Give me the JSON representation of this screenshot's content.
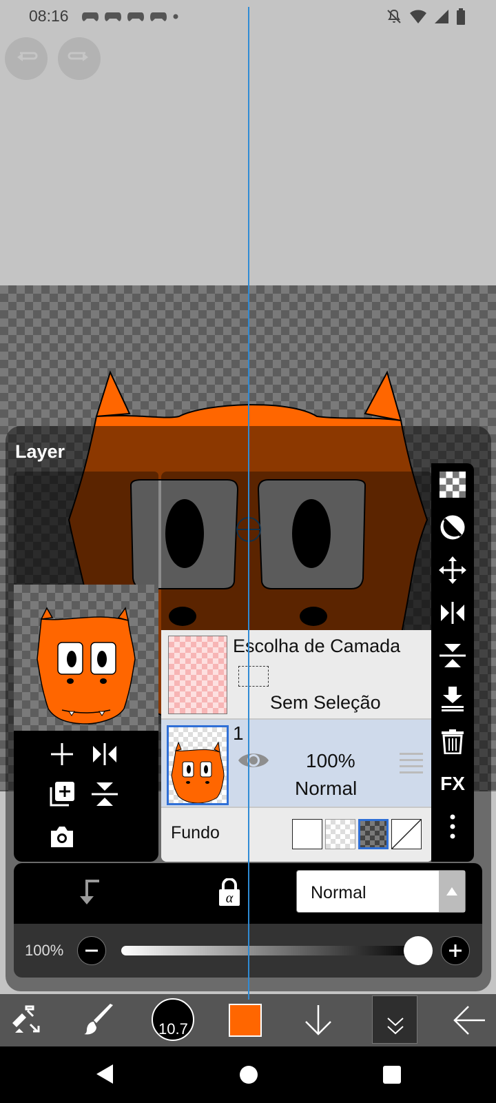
{
  "status_bar": {
    "time": "08:16",
    "left_icons": [
      "gamepad-icon",
      "gamepad-icon",
      "gamepad-icon",
      "gamepad-icon",
      "dot-icon"
    ],
    "right_icons": [
      "bell-off-icon",
      "wifi-icon",
      "signal-icon",
      "battery-icon"
    ]
  },
  "toolbar_top": {
    "undo_icon": "undo-icon",
    "redo_icon": "redo-icon"
  },
  "layer_panel": {
    "title": "Layer",
    "selection_row": {
      "title": "Escolha de Camada",
      "status": "Sem Seleção"
    },
    "layers": [
      {
        "number": "1",
        "opacity": "100%",
        "blend_mode": "Normal",
        "visible": true,
        "selected": true
      }
    ],
    "background_row": {
      "label": "Fundo",
      "options": [
        "white",
        "checker-light",
        "checker-dark",
        "none"
      ],
      "selected_option": "checker-dark"
    },
    "side_tools": [
      "checker-icon",
      "clipping-icon",
      "move-icon",
      "flip-horizontal-icon",
      "flip-vertical-icon",
      "merge-down-icon",
      "trash-icon",
      "fx-icon",
      "more-icon"
    ],
    "fx_label": "FX",
    "blend_select": {
      "value": "Normal"
    },
    "opacity": {
      "label": "100%",
      "value": 1.0
    }
  },
  "bottom_toolbar": {
    "brush_size": "10.7",
    "current_color": "#ff6600"
  },
  "colors": {
    "accent_blue": "#2f8bd5",
    "character_orange": "#ff6600",
    "selected_row": "#cfdaeb"
  }
}
